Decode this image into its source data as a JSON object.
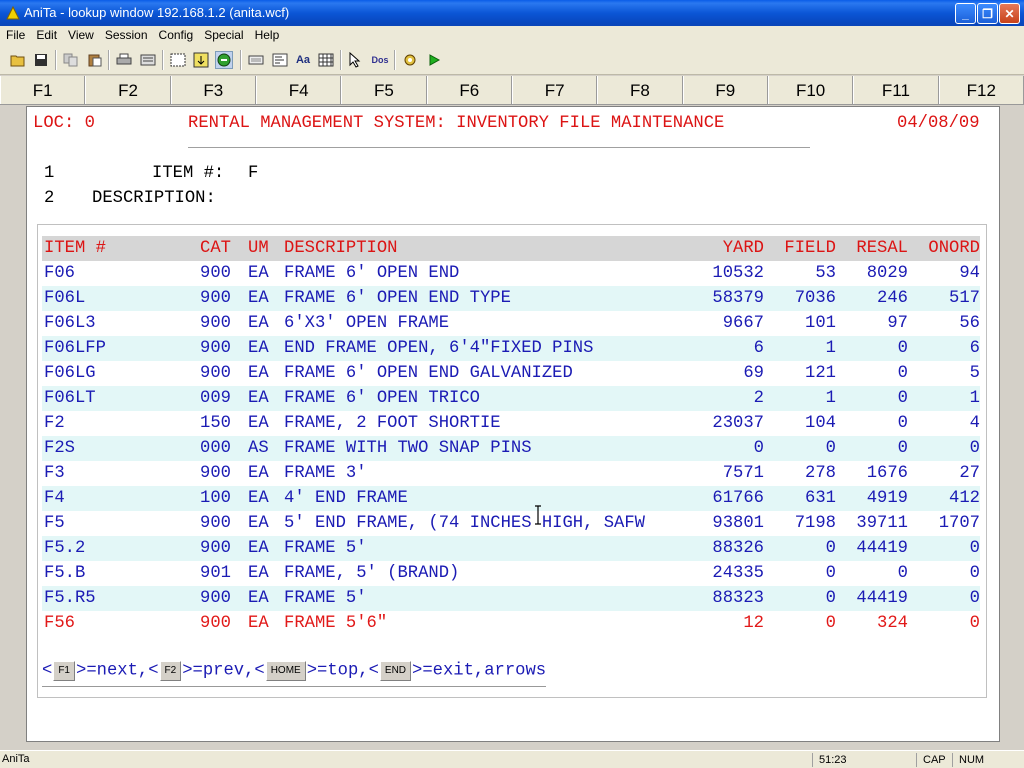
{
  "window": {
    "title": "AniTa - lookup window  192.168.1.2 (anita.wcf)",
    "minimize_glyph": "_",
    "maximize_glyph": "❐",
    "close_glyph": "✕"
  },
  "menu": [
    "File",
    "Edit",
    "View",
    "Session",
    "Config",
    "Special",
    "Help"
  ],
  "toolbar_icons": [
    "open-icon",
    "save-icon",
    "copy-icon",
    "paste-icon",
    "print-icon",
    "print-setup-icon",
    "capture-icon",
    "transfer-icon",
    "connect-icon",
    "keyboard-icon",
    "macro-icon",
    "font-icon",
    "grid-icon",
    "pointer-icon",
    "dos-icon",
    "settings-icon",
    "run-icon"
  ],
  "fkeys": [
    "F1",
    "F2",
    "F3",
    "F4",
    "F5",
    "F6",
    "F7",
    "F8",
    "F9",
    "F10",
    "F11",
    "F12"
  ],
  "screen": {
    "loc": "LOC: 0",
    "system_title": "RENTAL MANAGEMENT SYSTEM: INVENTORY FILE MAINTENANCE",
    "date": "04/08/09",
    "field1_num": "1",
    "field1_label": "ITEM #:",
    "field1_value": "F",
    "field2_num": "2",
    "field2_label": "DESCRIPTION:"
  },
  "table": {
    "headers": {
      "item": "ITEM #",
      "cat": "CAT",
      "um": "UM",
      "desc": "DESCRIPTION",
      "yard": "YARD",
      "field": "FIELD",
      "resal": "RESAL",
      "onord": "ONORD"
    },
    "rows": [
      {
        "item": "F06",
        "cat": "900",
        "um": "EA",
        "desc": "FRAME 6' OPEN END",
        "yard": "10532",
        "field": "53",
        "resal": "8029",
        "onord": "94"
      },
      {
        "item": "F06L",
        "cat": "900",
        "um": "EA",
        "desc": "FRAME 6' OPEN END TYPE",
        "yard": "58379",
        "field": "7036",
        "resal": "246",
        "onord": "517"
      },
      {
        "item": "F06L3",
        "cat": "900",
        "um": "EA",
        "desc": "6'X3' OPEN FRAME",
        "yard": "9667",
        "field": "101",
        "resal": "97",
        "onord": "56"
      },
      {
        "item": "F06LFP",
        "cat": "900",
        "um": "EA",
        "desc": "END FRAME OPEN, 6'4\"FIXED PINS",
        "yard": "6",
        "field": "1",
        "resal": "0",
        "onord": "6"
      },
      {
        "item": "F06LG",
        "cat": "900",
        "um": "EA",
        "desc": "FRAME 6' OPEN END GALVANIZED",
        "yard": "69",
        "field": "121",
        "resal": "0",
        "onord": "5"
      },
      {
        "item": "F06LT",
        "cat": "009",
        "um": "EA",
        "desc": "FRAME 6' OPEN TRICO",
        "yard": "2",
        "field": "1",
        "resal": "0",
        "onord": "1"
      },
      {
        "item": "F2",
        "cat": "150",
        "um": "EA",
        "desc": "FRAME, 2 FOOT SHORTIE",
        "yard": "23037",
        "field": "104",
        "resal": "0",
        "onord": "4"
      },
      {
        "item": "F2S",
        "cat": "000",
        "um": "AS",
        "desc": "FRAME WITH TWO SNAP PINS",
        "yard": "0",
        "field": "0",
        "resal": "0",
        "onord": "0"
      },
      {
        "item": "F3",
        "cat": "900",
        "um": "EA",
        "desc": "FRAME 3'",
        "yard": "7571",
        "field": "278",
        "resal": "1676",
        "onord": "27"
      },
      {
        "item": "F4",
        "cat": "100",
        "um": "EA",
        "desc": "4' END FRAME",
        "yard": "61766",
        "field": "631",
        "resal": "4919",
        "onord": "412"
      },
      {
        "item": "F5",
        "cat": "900",
        "um": "EA",
        "desc": "5' END FRAME, (74 INCHES HIGH, SAFW",
        "yard": "93801",
        "field": "7198",
        "resal": "39711",
        "onord": "1707"
      },
      {
        "item": "F5.2",
        "cat": "900",
        "um": "EA",
        "desc": "FRAME 5'",
        "yard": "88326",
        "field": "0",
        "resal": "44419",
        "onord": "0"
      },
      {
        "item": "F5.B",
        "cat": "901",
        "um": "EA",
        "desc": "FRAME, 5' (BRAND)",
        "yard": "24335",
        "field": "0",
        "resal": "0",
        "onord": "0"
      },
      {
        "item": "F5.R5",
        "cat": "900",
        "um": "EA",
        "desc": "FRAME 5'",
        "yard": "88323",
        "field": "0",
        "resal": "44419",
        "onord": "0"
      },
      {
        "item": "F56",
        "cat": "900",
        "um": "EA",
        "desc": "FRAME 5'6\"",
        "yard": "12",
        "field": "0",
        "resal": "324",
        "onord": "0"
      }
    ]
  },
  "help": {
    "lt1": "<",
    "key1": "F1",
    "txt1": ">=next,<",
    "key2": "F2",
    "txt2": ">=prev,<",
    "key3": "HOME",
    "txt3": ">=top,<",
    "key4": "END",
    "txt4": ">=exit,arrows"
  },
  "status": {
    "app": "AniTa",
    "position": "51:23",
    "cap": "CAP",
    "num": "NUM"
  },
  "colors": {
    "header_red": "#dc1414",
    "text_blue": "#1b1bb4",
    "alt_row": "#e3f7f7",
    "selected_row_red": "#e11919"
  }
}
